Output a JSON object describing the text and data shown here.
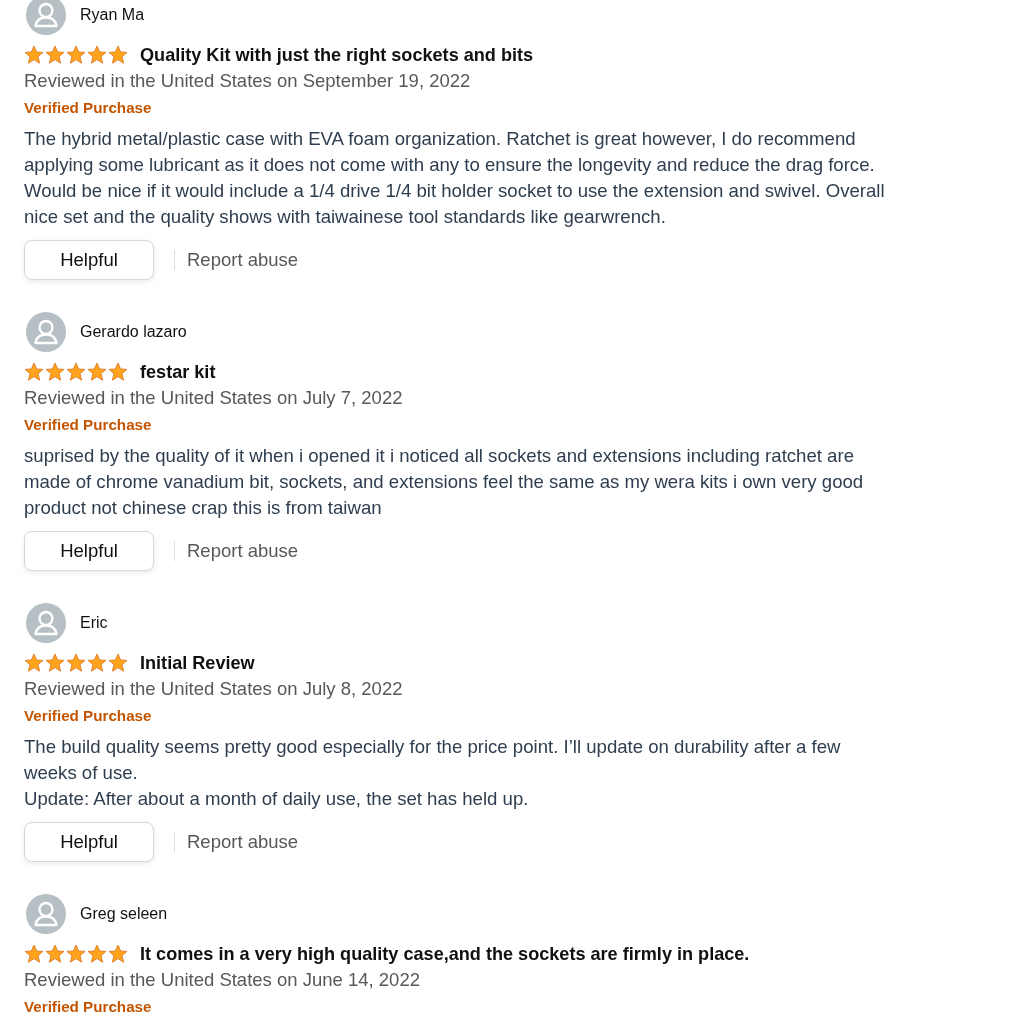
{
  "reviews": [
    {
      "reviewer": "Ryan Ma",
      "stars": 5,
      "title": "Quality Kit with just the right sockets and bits",
      "date": "Reviewed in the United States on September 19, 2022",
      "badge": "Verified Purchase",
      "body": [
        "The hybrid metal/plastic case with EVA foam organization. Ratchet is great however, I do recommend applying some lubricant as it does not come with any to ensure the longevity and reduce the drag force. Would be nice if it would include a 1/4 drive 1/4 bit holder socket to use the extension and swivel. Overall nice set and the quality shows with taiwainese tool standards like gearwrench."
      ],
      "helpful_button": "Helpful",
      "report_link": "Report abuse"
    },
    {
      "reviewer": "Gerardo lazaro",
      "stars": 5,
      "title": "festar kit",
      "date": "Reviewed in the United States on July 7, 2022",
      "badge": "Verified Purchase",
      "body": [
        "suprised by the quality of it when i opened it i noticed all sockets and extensions including ratchet are made of chrome vanadium bit, sockets, and extensions feel the same as my wera kits i own very good product not chinese crap this is from taiwan"
      ],
      "helpful_button": "Helpful",
      "report_link": "Report abuse"
    },
    {
      "reviewer": "Eric",
      "stars": 5,
      "title": "Initial Review",
      "date": "Reviewed in the United States on July 8, 2022",
      "badge": "Verified Purchase",
      "body": [
        "The build quality seems pretty good especially for the price point. I’ll update on durability after a few weeks of use.",
        "Update: After about a month of daily use, the set has held up."
      ],
      "helpful_button": "Helpful",
      "report_link": "Report abuse"
    },
    {
      "reviewer": "Greg seleen",
      "stars": 5,
      "title": "It comes in a very high quality case,and the sockets are firmly in place.",
      "date": "Reviewed in the United States on June 14, 2022",
      "badge": "Verified Purchase"
    }
  ]
}
